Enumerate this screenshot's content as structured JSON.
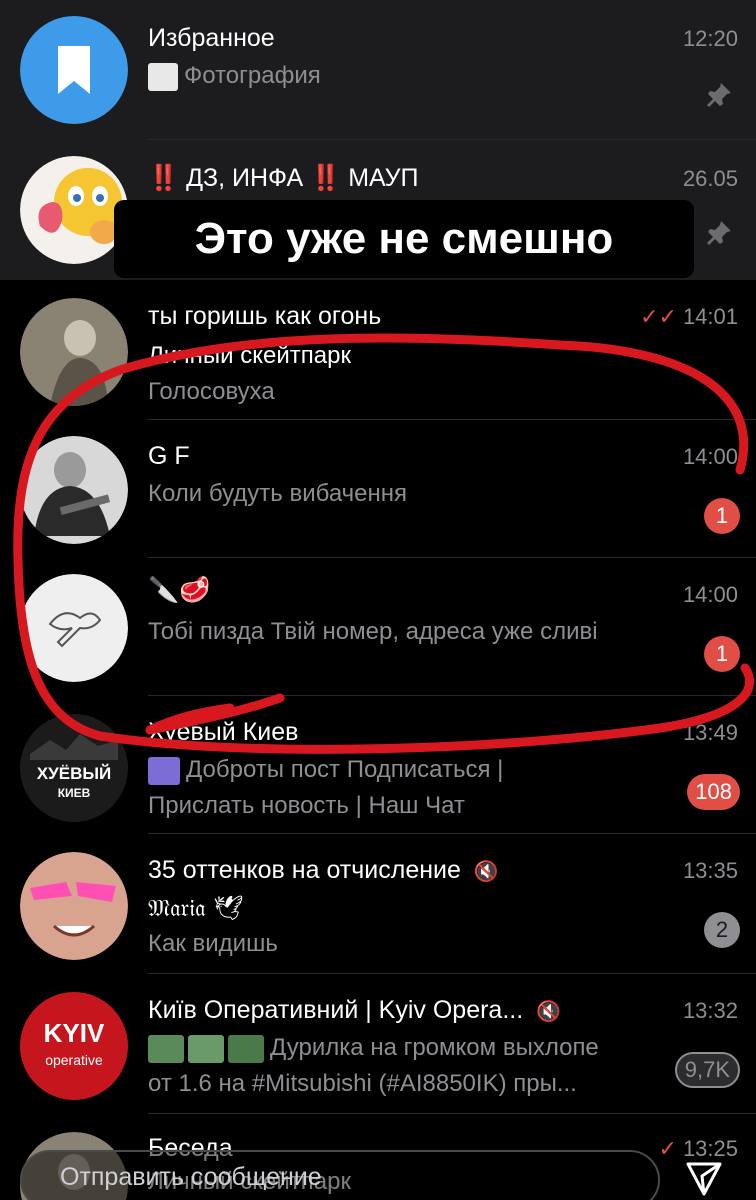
{
  "chats": [
    {
      "name": "Избранное",
      "lines": [
        "Фотография"
      ],
      "time": "12:20",
      "pinned": true
    },
    {
      "name": "ДЗ, ИНФА",
      "name_suffix": "МАУП",
      "alarm_glyph": "‼️",
      "lines": [],
      "time": "26.05",
      "pinned": true
    },
    {
      "name": "ты горишь как огонь",
      "lines": [
        "Личный скейтпарк",
        "Голосовуха"
      ],
      "time": "14:01",
      "read_status": "double-check"
    },
    {
      "name": "G F",
      "lines": [
        "Коли будуть вибачення"
      ],
      "time": "14:00",
      "badge": "1"
    },
    {
      "name": "🔪🥩",
      "lines": [
        "Тобі пизда Твій номер, адреса уже сливі"
      ],
      "time": "14:00",
      "badge": "1"
    },
    {
      "name": "Хуёвый Киев",
      "lines": [
        "Доброты пост Подписаться |",
        "Прислать новость | Наш Чат"
      ],
      "time": "13:49",
      "badge": "108",
      "avatar_text": "ХУЁВЫЙ",
      "avatar_sub": "КИЕВ"
    },
    {
      "name": "35 оттенков на отчисление",
      "lines": [
        "𝔐𝔞𝔯𝔦𝔞 🕊",
        "Как видишь"
      ],
      "time": "13:35",
      "badge": "2",
      "muted": true
    },
    {
      "name": "Київ Оперативний | Kyiv Opera...",
      "lines": [
        "Дурилка на громком выхлопе",
        "от 1.6 на #Mitsubishi (#AI8850IK) пры..."
      ],
      "time": "13:32",
      "badge": "9,7K",
      "muted": true,
      "avatar_text": "KYIV",
      "avatar_sub": "operative"
    },
    {
      "name": "Беседа",
      "lines": [
        "Личный скейтпарк"
      ],
      "time": "13:25",
      "read_status": "check"
    }
  ],
  "caption": "Это уже не смешно",
  "reply_placeholder": "Отправить сообщение",
  "colors": {
    "background": "#000000",
    "pinned_row": "#1c1c1e",
    "badge": "#e04e46",
    "annotation": "#d7191f",
    "checkmark": "#e04e46"
  }
}
